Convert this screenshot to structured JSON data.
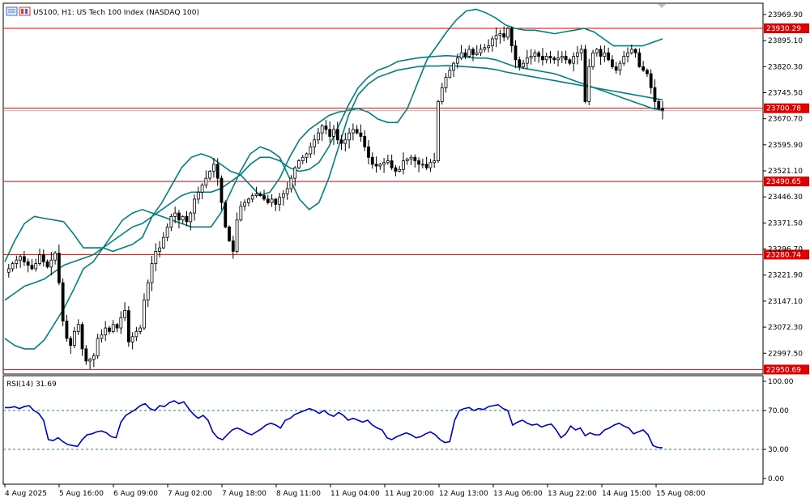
{
  "header": {
    "symbol_text": "US100, H1:  US Tech 100 Index (NASDAQ 100)",
    "icons": [
      "chart-type-icon",
      "period-icon"
    ]
  },
  "indicator": {
    "label": "RSI(14) 31.69"
  },
  "colors": {
    "bull_candle": "#000000",
    "bear_candle": "#000000",
    "bollinger": "#008080",
    "hline": "#e00000",
    "rsi": "#0000cc",
    "grid_level": "#2e8b57",
    "background": "#ffffff"
  },
  "chart_data": [
    {
      "type": "candlestick",
      "title": "US100, H1:  US Tech 100 Index (NASDAQ 100)",
      "y_ticks": [
        "23969.90",
        "23895.10",
        "23820.30",
        "23745.50",
        "23670.70",
        "23595.90",
        "23521.10",
        "23446.30",
        "23371.50",
        "23296.70",
        "23221.90",
        "23147.10",
        "23072.30",
        "22997.50"
      ],
      "ylim": [
        22940,
        24000
      ],
      "x_ticks": [
        "4 Aug 2025",
        "5 Aug 16:00",
        "6 Aug 09:00",
        "7 Aug 02:00",
        "7 Aug 18:00",
        "8 Aug 11:00",
        "11 Aug 04:00",
        "11 Aug 20:00",
        "12 Aug 13:00",
        "13 Aug 06:00",
        "13 Aug 22:00",
        "14 Aug 15:00",
        "15 Aug 08:00"
      ],
      "horizontal_lines": [
        {
          "value": 23930.29,
          "label": "23930.29"
        },
        {
          "value": 23700.78,
          "label": "23700.78"
        },
        {
          "value": 23490.65,
          "label": "23490.65"
        },
        {
          "value": 23280.74,
          "label": "23280.74"
        },
        {
          "value": 22950.69,
          "label": "22950.69"
        }
      ],
      "current_price": 23693.5,
      "close_path": [
        23230,
        23240,
        23255,
        23265,
        23275,
        23260,
        23250,
        23240,
        23255,
        23280,
        23260,
        23245,
        23265,
        23285,
        23200,
        23090,
        23040,
        23020,
        23060,
        23080,
        23010,
        22975,
        22980,
        22990,
        23040,
        23050,
        23070,
        23060,
        23080,
        23070,
        23100,
        23120,
        23030,
        23045,
        23060,
        23070,
        23150,
        23200,
        23255,
        23290,
        23300,
        23330,
        23360,
        23390,
        23400,
        23380,
        23390,
        23375,
        23400,
        23440,
        23460,
        23480,
        23500,
        23520,
        23540,
        23500,
        23430,
        23360,
        23320,
        23290,
        23380,
        23420,
        23430,
        23440,
        23450,
        23455,
        23450,
        23440,
        23430,
        23440,
        23425,
        23445,
        23455,
        23470,
        23500,
        23530,
        23550,
        23560,
        23570,
        23590,
        23610,
        23630,
        23650,
        23640,
        23620,
        23640,
        23610,
        23600,
        23610,
        23630,
        23640,
        23630,
        23620,
        23590,
        23560,
        23540,
        23535,
        23540,
        23545,
        23550,
        23530,
        23520,
        23525,
        23550,
        23555,
        23560,
        23550,
        23540,
        23540,
        23530,
        23545,
        23550,
        23720,
        23760,
        23790,
        23810,
        23830,
        23845,
        23860,
        23850,
        23870,
        23855,
        23860,
        23870,
        23875,
        23880,
        23900,
        23910,
        23915,
        23905,
        23930,
        23880,
        23840,
        23820,
        23830,
        23845,
        23850,
        23860,
        23850,
        23840,
        23850,
        23845,
        23840,
        23845,
        23850,
        23840,
        23830,
        23850,
        23860,
        23870,
        23720,
        23820,
        23860,
        23870,
        23850,
        23860,
        23840,
        23820,
        23810,
        23830,
        23850,
        23860,
        23870,
        23860,
        23820,
        23810,
        23800,
        23760,
        23720,
        23700,
        23693.5
      ],
      "bollinger": {
        "upper": [
          23260,
          23320,
          23370,
          23390,
          23385,
          23380,
          23375,
          23340,
          23300,
          23300,
          23300,
          23290,
          23300,
          23310,
          23330,
          23390,
          23430,
          23480,
          23530,
          23560,
          23570,
          23560,
          23540,
          23520,
          23510,
          23480,
          23450,
          23460,
          23500,
          23560,
          23610,
          23640,
          23660,
          23680,
          23690,
          23695,
          23700,
          23690,
          23670,
          23660,
          23660,
          23700,
          23770,
          23840,
          23880,
          23920,
          23955,
          23980,
          23985,
          23975,
          23960,
          23940,
          23930,
          23925,
          23925,
          23920,
          23915,
          23920,
          23925,
          23930,
          23920,
          23900,
          23880,
          23880,
          23880,
          23880,
          23890,
          23900
        ],
        "middle": [
          23150,
          23170,
          23190,
          23200,
          23210,
          23230,
          23250,
          23260,
          23270,
          23280,
          23300,
          23320,
          23340,
          23360,
          23370,
          23390,
          23410,
          23430,
          23450,
          23460,
          23460,
          23460,
          23470,
          23490,
          23510,
          23540,
          23560,
          23560,
          23550,
          23530,
          23520,
          23525,
          23545,
          23590,
          23650,
          23710,
          23760,
          23790,
          23810,
          23820,
          23835,
          23840,
          23845,
          23848,
          23850,
          23852,
          23850,
          23848,
          23845,
          23845,
          23840,
          23830,
          23820,
          23815,
          23810,
          23805,
          23800,
          23790,
          23780,
          23770,
          23760,
          23750,
          23740,
          23730,
          23720,
          23710,
          23700,
          23695
        ],
        "lower": [
          23040,
          23020,
          23010,
          23010,
          23035,
          23080,
          23125,
          23180,
          23240,
          23260,
          23300,
          23340,
          23380,
          23400,
          23410,
          23400,
          23390,
          23380,
          23370,
          23360,
          23360,
          23360,
          23400,
          23460,
          23520,
          23570,
          23590,
          23580,
          23560,
          23500,
          23440,
          23410,
          23430,
          23500,
          23590,
          23680,
          23740,
          23770,
          23790,
          23800,
          23810,
          23815,
          23820,
          23822,
          23822,
          23823,
          23822,
          23820,
          23818,
          23816,
          23812,
          23805,
          23800,
          23795,
          23790,
          23785,
          23780,
          23775,
          23770,
          23765,
          23760,
          23755,
          23750,
          23745,
          23740,
          23735,
          23730,
          23725
        ]
      },
      "ylabel": "",
      "xlabel": ""
    },
    {
      "type": "line",
      "title": "RSI(14) 31.69",
      "y_ticks": [
        "100.00",
        "70.00",
        "30.00",
        "0.00"
      ],
      "ylim": [
        0,
        100
      ],
      "levels": [
        70,
        30
      ],
      "values": [
        73,
        73,
        74,
        72,
        74,
        75,
        70,
        67,
        60,
        40,
        39,
        42,
        38,
        35,
        34,
        33,
        40,
        45,
        46,
        48,
        49,
        47,
        43,
        42,
        58,
        65,
        68,
        71,
        75,
        77,
        72,
        70,
        75,
        74,
        78,
        80,
        77,
        79,
        72,
        66,
        62,
        65,
        60,
        48,
        42,
        40,
        45,
        50,
        52,
        50,
        47,
        45,
        48,
        51,
        55,
        57,
        55,
        52,
        60,
        62,
        66,
        68,
        70,
        72,
        70,
        67,
        70,
        66,
        64,
        68,
        65,
        60,
        62,
        60,
        58,
        60,
        55,
        52,
        50,
        42,
        40,
        43,
        45,
        47,
        45,
        42,
        43,
        46,
        48,
        45,
        40,
        37,
        38,
        60,
        70,
        72,
        73,
        70,
        72,
        71,
        74,
        75,
        76,
        72,
        70,
        55,
        58,
        60,
        57,
        55,
        56,
        53,
        55,
        56,
        50,
        42,
        46,
        54,
        50,
        52,
        44,
        47,
        45,
        45,
        50,
        52,
        55,
        57,
        54,
        52,
        46,
        48,
        50,
        45,
        34,
        32,
        31.69
      ]
    }
  ]
}
